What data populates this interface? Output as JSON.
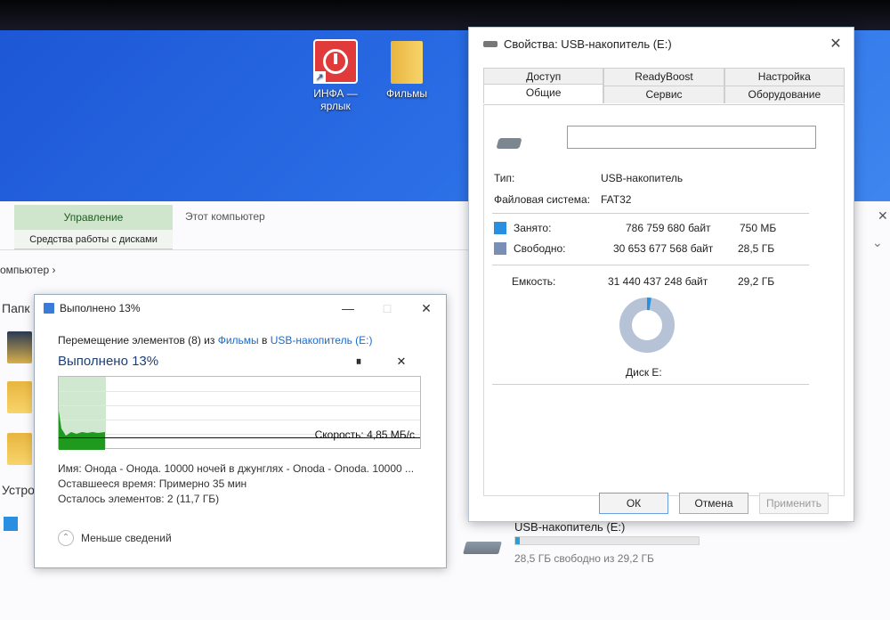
{
  "desktop": {
    "icons": [
      {
        "label": "ИНФА — ярлык",
        "icon": "power-shortcut-icon"
      },
      {
        "label": "Фильмы",
        "icon": "folder-icon"
      }
    ]
  },
  "explorer": {
    "ribbon_context_tab": "Управление",
    "ribbon_context_group": "Средства работы с дисками",
    "ribbon_title": "Этот компьютер",
    "breadcrumb": "омпьютер  ›",
    "section_folders": "Папк",
    "section_devices": "Устро",
    "drive": {
      "name": "USB-накопитель (E:)",
      "free_text": "28,5 ГБ свободно из 29,2 ГБ",
      "used_fraction": 0.025
    }
  },
  "progress": {
    "title": "Выполнено 13%",
    "move_prefix": "Перемещение элементов (8) из ",
    "move_from": "Фильмы",
    "move_mid": " в ",
    "move_to": "USB-накопитель (E:)",
    "percent_text": "Выполнено 13%",
    "percent": 13,
    "pause_label": "⏸",
    "cancel_label": "✕",
    "speed": "Скорость: 4,85 МБ/с",
    "name_line": "Имя: Онода - Онода. 10000 ночей в джунглях - Onoda - Onoda. 10000 ...",
    "remaining_time": "Оставшееся время: Примерно 35 мин",
    "remaining_items": "Осталось элементов: 2 (11,7 ГБ)",
    "less_details": "Меньше сведений",
    "titlebar_minimize": "—",
    "titlebar_close": "✕"
  },
  "properties": {
    "title": "Свойства: USB-накопитель (E:)",
    "close_label": "✕",
    "tabs_row1": [
      "Доступ",
      "ReadyBoost",
      "Настройка"
    ],
    "tabs_row2": [
      "Общие",
      "Сервис",
      "Оборудование"
    ],
    "active_tab": "Общие",
    "volume_label_value": "",
    "type_label": "Тип:",
    "type_value": "USB-накопитель",
    "fs_label": "Файловая система:",
    "fs_value": "FAT32",
    "used_label": "Занято:",
    "used_bytes": "786 759 680 байт",
    "used_size": "750 МБ",
    "free_label": "Свободно:",
    "free_bytes": "30 653 677 568 байт",
    "free_size": "28,5 ГБ",
    "capacity_label": "Емкость:",
    "capacity_bytes": "31 440 437 248 байт",
    "capacity_size": "29,2 ГБ",
    "disk_label": "Диск E:",
    "used_fraction": 0.025,
    "colors": {
      "used": "#2a8fe0",
      "free": "#7a8fb5"
    },
    "buttons": {
      "ok": "ОК",
      "cancel": "Отмена",
      "apply": "Применить"
    }
  }
}
